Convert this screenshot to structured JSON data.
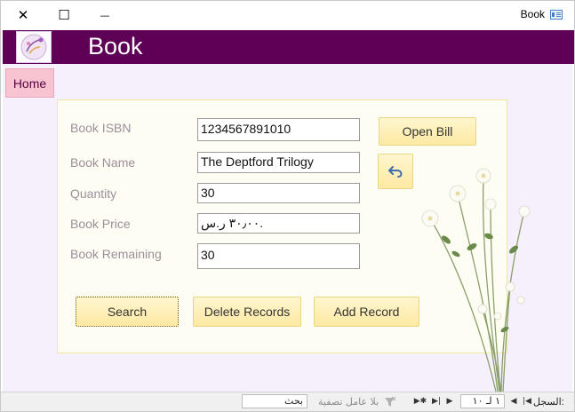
{
  "window": {
    "title": "Book",
    "close_glyph": "✕",
    "maximize_glyph": "☐",
    "minimize_glyph": "—"
  },
  "header": {
    "title": "Book",
    "background": "#5e0056"
  },
  "nav": {
    "home_label": "Home"
  },
  "form": {
    "labels": {
      "isbn": "Book ISBN",
      "name": "Book Name",
      "quantity": "Quantity",
      "price": "Book Price",
      "remaining": "Book Remaining"
    },
    "values": {
      "isbn": "1234567891010",
      "name": "The Deptford Trilogy",
      "quantity": "30",
      "price": "٣٠٫٠٠ ر.س.",
      "remaining": "30"
    }
  },
  "buttons": {
    "open_bill": "Open Bill",
    "undo_icon": "undo-icon",
    "search": "Search",
    "delete": "Delete Records",
    "add": "Add Record"
  },
  "status_bar": {
    "record_label": "السجل:",
    "record_position": "١ لـ ١٠",
    "filter_label": "بلا عامل تصفية",
    "search_label": "بحث"
  },
  "colors": {
    "canvas": "#f6effc",
    "button_yellow": "#fde9a2",
    "home_pink": "#f8c4d2"
  }
}
